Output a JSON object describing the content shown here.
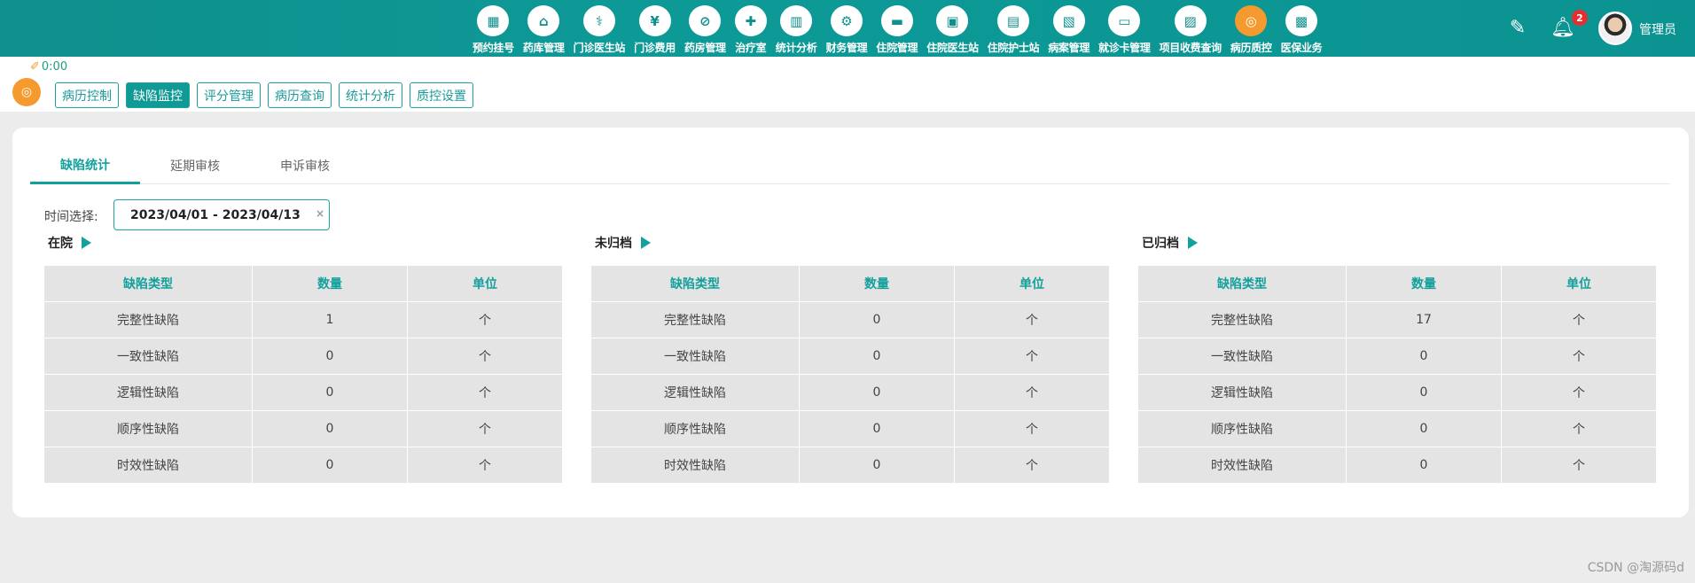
{
  "nav": {
    "items": [
      {
        "label": "预约挂号",
        "icon": "calendar-icon",
        "glyph": "▦"
      },
      {
        "label": "药库管理",
        "icon": "medicine-store-icon",
        "glyph": "⌂"
      },
      {
        "label": "门诊医生站",
        "icon": "doctor-icon",
        "glyph": "⚕"
      },
      {
        "label": "门诊费用",
        "icon": "yen-icon",
        "glyph": "¥"
      },
      {
        "label": "药房管理",
        "icon": "pill-icon",
        "glyph": "⊘"
      },
      {
        "label": "治疗室",
        "icon": "nurse-icon",
        "glyph": "✚"
      },
      {
        "label": "统计分析",
        "icon": "bar-chart-icon",
        "glyph": "▥"
      },
      {
        "label": "财务管理",
        "icon": "gear-icon",
        "glyph": "⚙"
      },
      {
        "label": "住院管理",
        "icon": "bed-icon",
        "glyph": "▬"
      },
      {
        "label": "住院医生站",
        "icon": "doctor-id-icon",
        "glyph": "▣"
      },
      {
        "label": "住院护士站",
        "icon": "nurse-id-icon",
        "glyph": "▤"
      },
      {
        "label": "病案管理",
        "icon": "record-icon",
        "glyph": "▧"
      },
      {
        "label": "就诊卡管理",
        "icon": "card-icon",
        "glyph": "▭"
      },
      {
        "label": "项目收费查询",
        "icon": "search-doc-icon",
        "glyph": "▨"
      },
      {
        "label": "病历质控",
        "icon": "quality-control-icon",
        "glyph": "◎",
        "active": true
      },
      {
        "label": "医保业务",
        "icon": "insurance-icon",
        "glyph": "▩"
      }
    ]
  },
  "header": {
    "edit_icon": "pencil-icon",
    "bell_icon": "bell-icon",
    "badge_count": "2",
    "username": "管理员"
  },
  "subheader": {
    "timer": "0:00",
    "module_icon": "quality-control-icon",
    "buttons": [
      {
        "label": "病历控制"
      },
      {
        "label": "缺陷监控",
        "active": true
      },
      {
        "label": "评分管理"
      },
      {
        "label": "病历查询"
      },
      {
        "label": "统计分析"
      },
      {
        "label": "质控设置"
      }
    ]
  },
  "tabs": [
    {
      "label": "缺陷统计",
      "active": true
    },
    {
      "label": "延期审核"
    },
    {
      "label": "申诉审核"
    }
  ],
  "filter": {
    "label": "时间选择:",
    "date_range": "2023/04/01 - 2023/04/13",
    "clear": "×"
  },
  "columns": [
    "缺陷类型",
    "数量",
    "单位"
  ],
  "panels": [
    {
      "title": "在院",
      "rows": [
        [
          "完整性缺陷",
          "1",
          "个"
        ],
        [
          "一致性缺陷",
          "0",
          "个"
        ],
        [
          "逻辑性缺陷",
          "0",
          "个"
        ],
        [
          "顺序性缺陷",
          "0",
          "个"
        ],
        [
          "时效性缺陷",
          "0",
          "个"
        ]
      ]
    },
    {
      "title": "未归档",
      "rows": [
        [
          "完整性缺陷",
          "0",
          "个"
        ],
        [
          "一致性缺陷",
          "0",
          "个"
        ],
        [
          "逻辑性缺陷",
          "0",
          "个"
        ],
        [
          "顺序性缺陷",
          "0",
          "个"
        ],
        [
          "时效性缺陷",
          "0",
          "个"
        ]
      ]
    },
    {
      "title": "已归档",
      "rows": [
        [
          "完整性缺陷",
          "17",
          "个"
        ],
        [
          "一致性缺陷",
          "0",
          "个"
        ],
        [
          "逻辑性缺陷",
          "0",
          "个"
        ],
        [
          "顺序性缺陷",
          "0",
          "个"
        ],
        [
          "时效性缺陷",
          "0",
          "个"
        ]
      ]
    }
  ],
  "watermark": "CSDN @淘源码d",
  "colors": {
    "brand": "#0f9a96",
    "accent": "#f59a2e",
    "badge": "#e52f2f"
  }
}
